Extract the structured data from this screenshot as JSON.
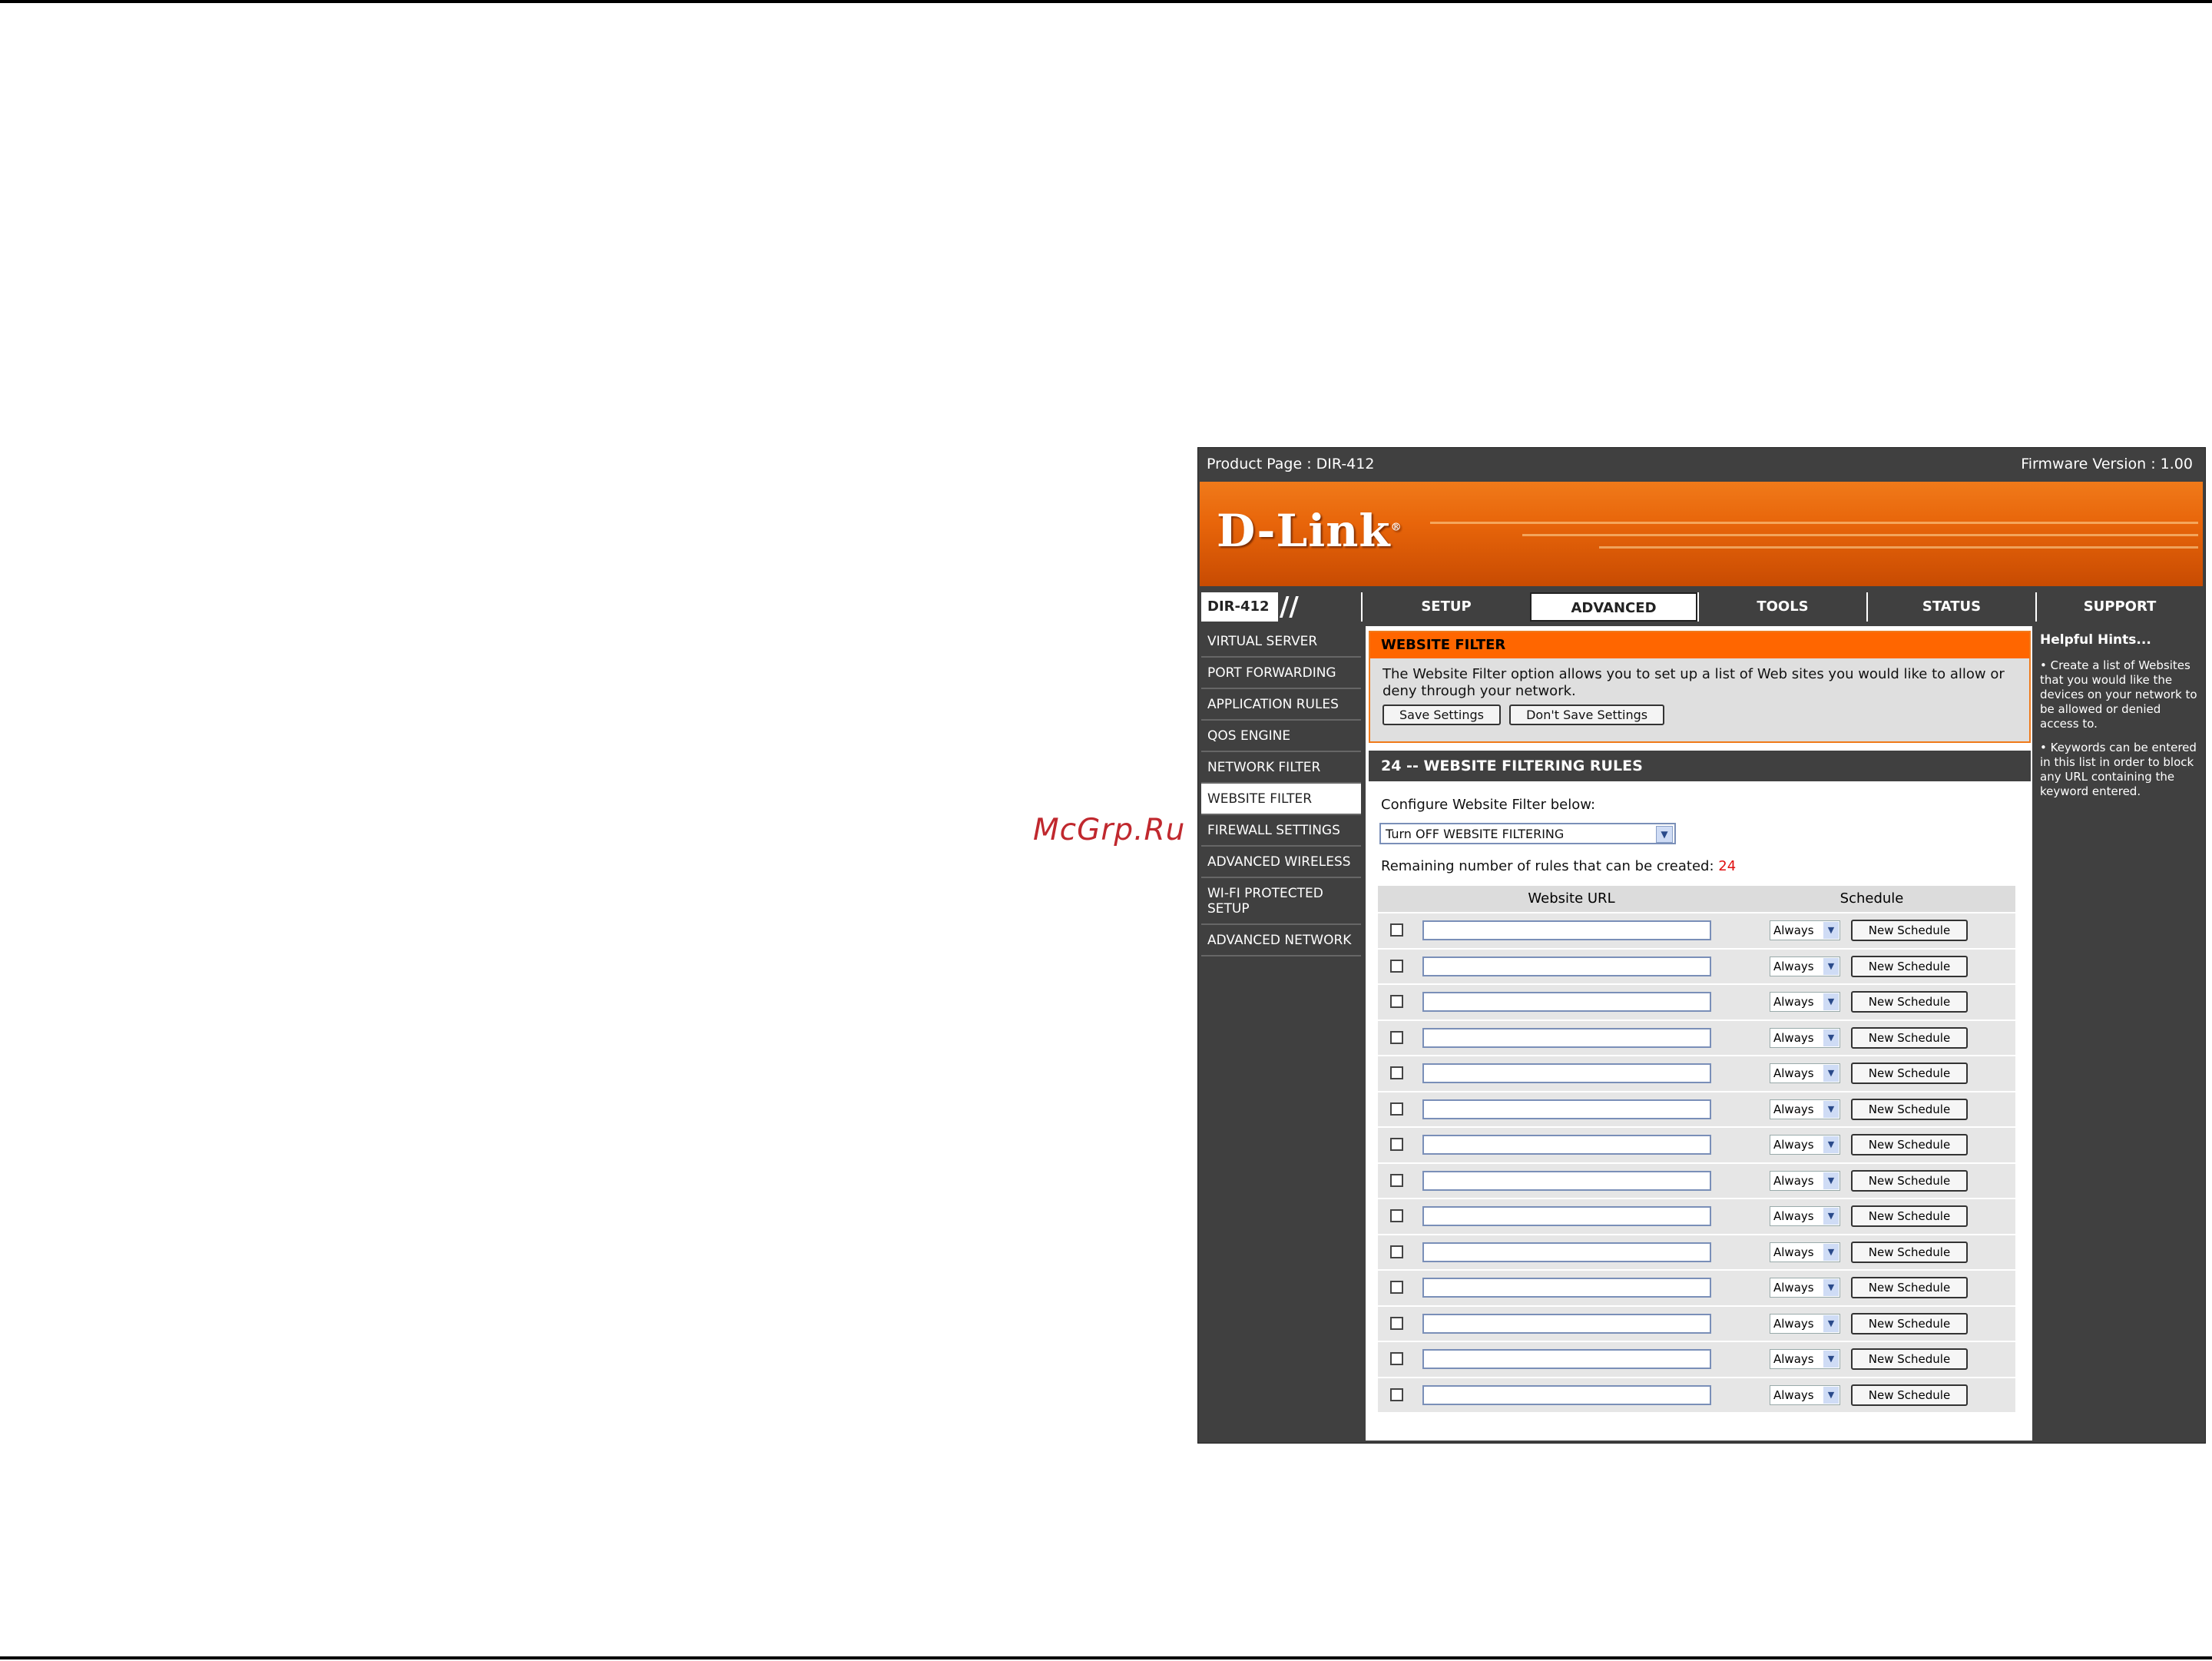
{
  "watermark": "McGrp.Ru",
  "header": {
    "product_page": "Product Page : DIR-412",
    "firmware_version": "Firmware Version : 1.00",
    "logo_text": "D-Link",
    "logo_mark": "®"
  },
  "nav": {
    "model": "DIR-412",
    "tabs": [
      {
        "label": "SETUP"
      },
      {
        "label": "ADVANCED"
      },
      {
        "label": "TOOLS"
      },
      {
        "label": "STATUS"
      },
      {
        "label": "SUPPORT"
      }
    ]
  },
  "sidebar": {
    "items": [
      {
        "label": "VIRTUAL SERVER"
      },
      {
        "label": "PORT FORWARDING"
      },
      {
        "label": "APPLICATION RULES"
      },
      {
        "label": "QOS ENGINE"
      },
      {
        "label": "NETWORK FILTER"
      },
      {
        "label": "WEBSITE FILTER"
      },
      {
        "label": "FIREWALL SETTINGS"
      },
      {
        "label": "ADVANCED WIRELESS"
      },
      {
        "label": "WI-FI PROTECTED SETUP"
      },
      {
        "label": "ADVANCED NETWORK"
      }
    ]
  },
  "website_filter": {
    "title": "WEBSITE FILTER",
    "description": "The Website Filter option allows you to set up a list of Web sites you would like to allow or deny through your network.",
    "save_label": "Save Settings",
    "dont_save_label": "Don't Save Settings"
  },
  "rules": {
    "title": "24 -- WEBSITE FILTERING RULES",
    "configure_label": "Configure Website Filter below:",
    "filter_mode_value": "Turn OFF WEBSITE FILTERING",
    "remaining_label": "Remaining number of rules that can be created:",
    "remaining_count": "24",
    "col_url": "Website URL",
    "col_schedule": "Schedule",
    "schedule_value": "Always",
    "new_schedule_label": "New Schedule",
    "visible_rows": 14
  },
  "hints": {
    "title": "Helpful Hints...",
    "items": [
      "• Create a list of Websites that you would like the devices on your network to be allowed or denied access to.",
      "• Keywords can be entered in this list in order to block any URL containing the keyword entered."
    ]
  },
  "colors": {
    "accent": "#ff6600",
    "dark": "#404040",
    "count_red": "#e01010"
  }
}
